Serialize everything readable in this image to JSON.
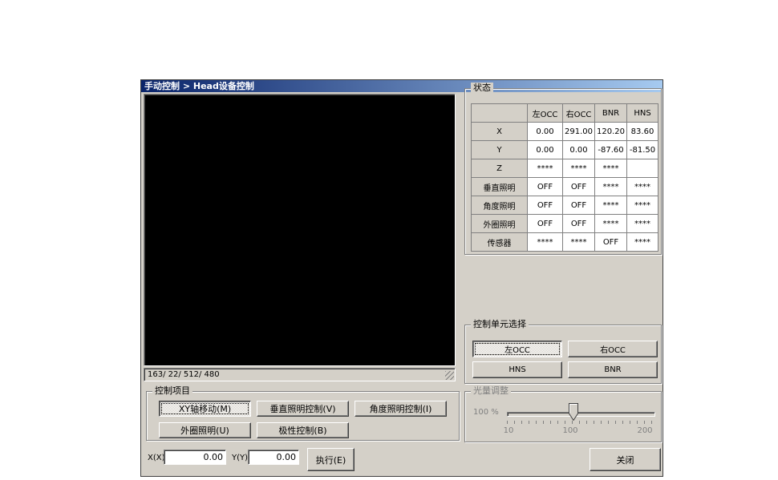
{
  "window": {
    "title": "手动控制 > Head设备控制"
  },
  "video": {
    "status_text": "163/ 22/ 512/ 480"
  },
  "status_group": {
    "title": "状态",
    "table": {
      "columns": [
        "",
        "左OCC",
        "右OCC",
        "BNR",
        "HNS"
      ],
      "rows": [
        {
          "label": "X",
          "values": [
            "0.00",
            "291.00",
            "120.20",
            "83.60"
          ]
        },
        {
          "label": "Y",
          "values": [
            "0.00",
            "0.00",
            "-87.60",
            "-81.50"
          ]
        },
        {
          "label": "Z",
          "values": [
            "****",
            "****",
            "****",
            ""
          ]
        },
        {
          "label": "垂直照明",
          "values": [
            "OFF",
            "OFF",
            "****",
            "****"
          ]
        },
        {
          "label": "角度照明",
          "values": [
            "OFF",
            "OFF",
            "****",
            "****"
          ]
        },
        {
          "label": "外圈照明",
          "values": [
            "OFF",
            "OFF",
            "****",
            "****"
          ]
        },
        {
          "label": "传感器",
          "values": [
            "****",
            "****",
            "OFF",
            "****"
          ]
        }
      ]
    }
  },
  "unit_group": {
    "title": "控制单元选择",
    "buttons": [
      {
        "label": "左OCC",
        "selected": true
      },
      {
        "label": "右OCC",
        "selected": false
      },
      {
        "label": "HNS",
        "selected": false
      },
      {
        "label": "BNR",
        "selected": false
      }
    ]
  },
  "control_group": {
    "title": "控制项目",
    "buttons": [
      {
        "label": "XY轴移动(M)",
        "selected": true
      },
      {
        "label": "垂直照明控制(V)",
        "selected": false
      },
      {
        "label": "角度照明控制(I)",
        "selected": false
      },
      {
        "label": "外圈照明(U)",
        "selected": false
      },
      {
        "label": "极性控制(B)",
        "selected": false
      }
    ]
  },
  "light_group": {
    "title": "光量调整",
    "value_label": "100 %",
    "min_label": "10",
    "mid_label": "100",
    "max_label": "200",
    "min": 10,
    "max": 200,
    "value": 100,
    "enabled": false
  },
  "bottom": {
    "x_label": "X(X)",
    "x_value": "0.00",
    "y_label": "Y(Y)",
    "y_value": "0.00",
    "execute_label": "执行(E)",
    "close_label": "关闭"
  },
  "colors": {
    "dialog_bg": "#D4D0C8",
    "titlebar_start": "#0A246A",
    "titlebar_end": "#A6CAF0",
    "disabled_text": "#808080"
  }
}
